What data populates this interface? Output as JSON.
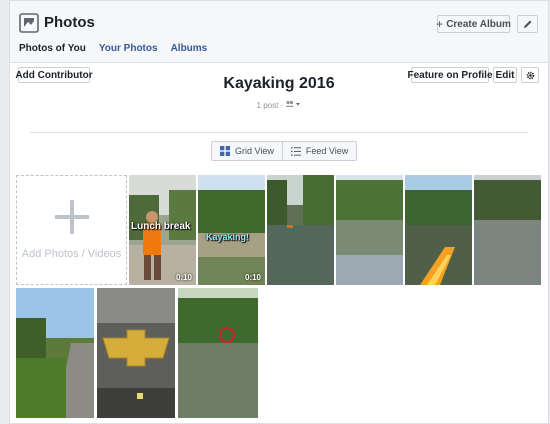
{
  "header": {
    "title": "Photos",
    "create_album_label": "Create Album",
    "tabs": [
      {
        "label": "Photos of You"
      },
      {
        "label": "Your Photos"
      },
      {
        "label": "Albums"
      }
    ]
  },
  "album": {
    "title": "Kayaking 2016",
    "meta": "1 post ·",
    "add_contributor_label": "Add Contributor",
    "feature_label": "Feature on Profile",
    "edit_label": "Edit"
  },
  "view_toggle": {
    "grid_label": "Grid View",
    "feed_label": "Feed View",
    "selected": "grid"
  },
  "add_tile": {
    "label": "Add Photos / Videos"
  },
  "photos": [
    {
      "overlay": "Lunch break",
      "duration": "0:10",
      "kind": "video"
    },
    {
      "overlay": "Kayaking!",
      "duration": "0:10",
      "kind": "video"
    },
    {
      "kind": "photo"
    },
    {
      "kind": "photo"
    },
    {
      "kind": "photo"
    },
    {
      "kind": "photo"
    },
    {
      "kind": "photo"
    },
    {
      "kind": "photo"
    },
    {
      "kind": "photo"
    }
  ],
  "colors": {
    "link": "#365899",
    "header_bg": "#f6f7f9",
    "grid_icon": "#4267b2"
  }
}
